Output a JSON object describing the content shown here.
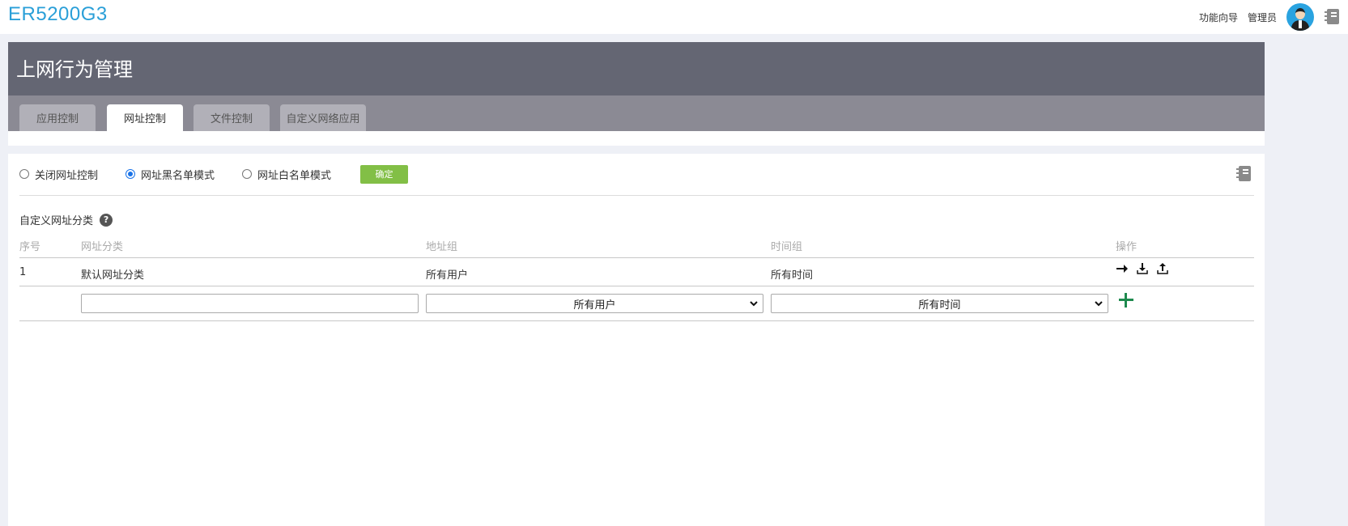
{
  "app": {
    "title": "ER5200G3"
  },
  "topbar": {
    "wizard_label": "功能向导",
    "user_label": "管理员"
  },
  "header": {
    "title": "上网行为管理"
  },
  "tabs": [
    {
      "label": "应用控制",
      "active": false
    },
    {
      "label": "网址控制",
      "active": true
    },
    {
      "label": "文件控制",
      "active": false
    },
    {
      "label": "自定义网络应用",
      "active": false
    }
  ],
  "mode": {
    "options": [
      {
        "label": "关闭网址控制",
        "selected": false
      },
      {
        "label": "网址黑名单模式",
        "selected": true
      },
      {
        "label": "网址白名单模式",
        "selected": false
      }
    ],
    "confirm_label": "确定"
  },
  "section": {
    "title": "自定义网址分类"
  },
  "table": {
    "columns": [
      "序号",
      "网址分类",
      "地址组",
      "时间组",
      "操作"
    ],
    "rows": [
      {
        "index": "1",
        "category": "默认网址分类",
        "address_group": "所有用户",
        "time_group": "所有时间"
      }
    ],
    "new_row": {
      "category_value": "",
      "address_group_selected": "所有用户",
      "time_group_selected": "所有时间"
    }
  },
  "icons": [
    "arrow-right-icon",
    "download-icon",
    "upload-icon",
    "add-icon",
    "notebook-icon",
    "help-icon"
  ],
  "colors": {
    "brand": "#2a9fd8",
    "header_bg": "#646673",
    "tab_bar_bg": "#8b8a94",
    "confirm_bg": "#82bf46",
    "add_icon": "#1e8a4e"
  }
}
